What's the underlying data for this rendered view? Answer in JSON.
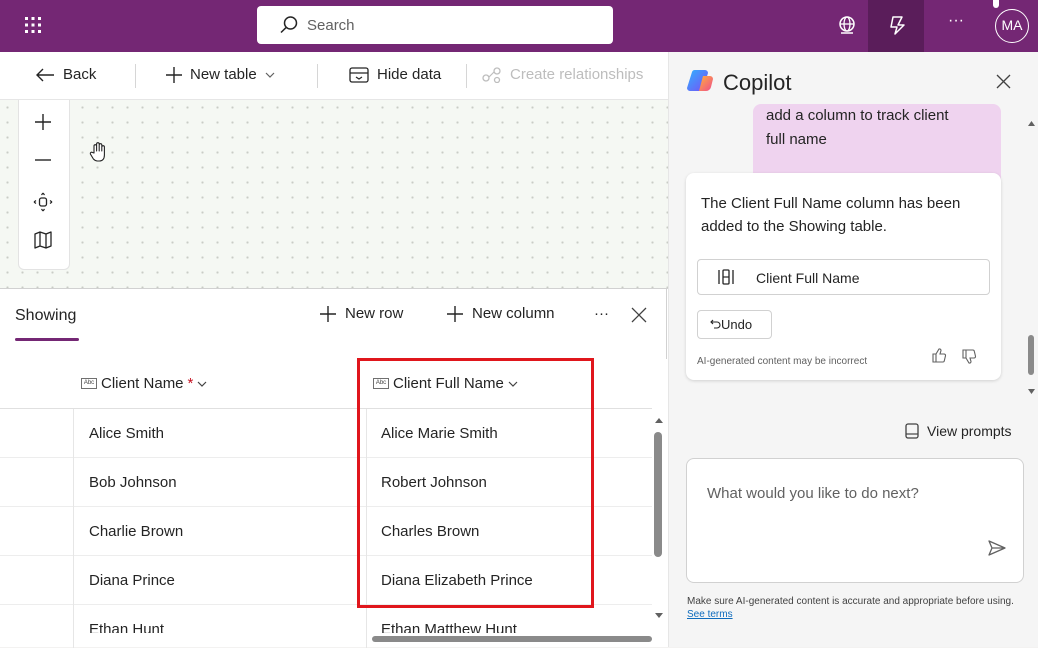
{
  "topbar": {
    "search_placeholder": "Search",
    "avatar_initials": "MA",
    "more": "···"
  },
  "commandbar": {
    "back": "Back",
    "new_table": "New table",
    "hide_data": "Hide data",
    "create_relationships": "Create relationships"
  },
  "panel": {
    "tab": "Showing",
    "new_row": "New row",
    "new_column": "New column",
    "more": "···"
  },
  "grid": {
    "columns": [
      {
        "label": "Client Name",
        "required": "*"
      },
      {
        "label": "Client Full Name"
      }
    ],
    "rows": [
      {
        "client_name": "Alice Smith",
        "client_full_name": "Alice Marie Smith"
      },
      {
        "client_name": "Bob Johnson",
        "client_full_name": "Robert Johnson"
      },
      {
        "client_name": "Charlie Brown",
        "client_full_name": "Charles Brown"
      },
      {
        "client_name": "Diana Prince",
        "client_full_name": "Diana Elizabeth Prince"
      },
      {
        "client_name": "Ethan Hunt",
        "client_full_name": "Ethan Matthew Hunt"
      }
    ]
  },
  "copilot": {
    "title": "Copilot",
    "user_message_line1": "add a column to track client",
    "user_message_line2": "full name",
    "bot_line1": "The Client Full Name column has been",
    "bot_line2": "added to the Showing table.",
    "column_chip": "Client Full Name",
    "undo": "Undo",
    "disclaimer": "AI-generated content may be incorrect",
    "view_prompts": "View prompts",
    "input_placeholder": "What would you like to do next?",
    "footer_text": "Make sure AI-generated content is accurate and appropriate before using.",
    "footer_link": "See terms"
  },
  "colors": {
    "brand": "#742774",
    "highlight": "#e0161c",
    "user_bubble": "#efd3ef"
  }
}
